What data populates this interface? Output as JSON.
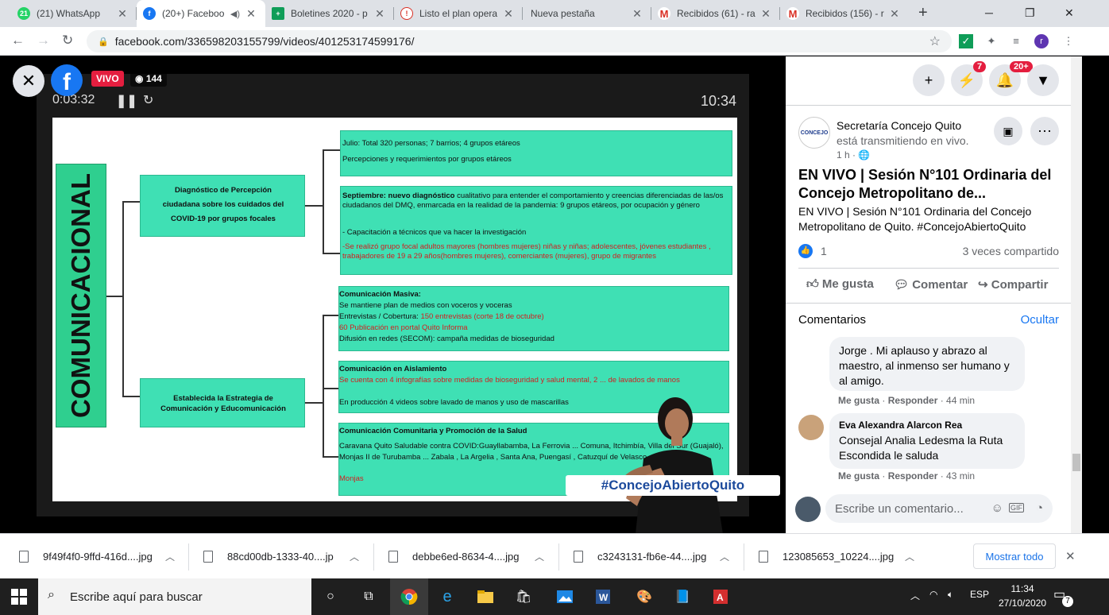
{
  "browser": {
    "tabs": [
      {
        "title": "(21) WhatsApp",
        "badge": "21"
      },
      {
        "title": "(20+) Faceboo"
      },
      {
        "title": "Boletines 2020 - p"
      },
      {
        "title": "Listo el plan opera"
      },
      {
        "title": "Nueva pestaña"
      },
      {
        "title": "Recibidos (61) - ra"
      },
      {
        "title": "Recibidos (156) - r"
      }
    ],
    "url": "facebook.com/336598203155799/videos/401253174599176/",
    "profile_initial": "r"
  },
  "video": {
    "live_label": "VIVO",
    "viewers": "144",
    "elapsed": "0:03:32",
    "clock": "10:34",
    "hashtag": "#ConcejoAbiertoQuito"
  },
  "slide": {
    "vertical_label": "COMUNICACIONAL",
    "box1_title": "Diagnóstico de Percepción ciudadana sobre los cuidados del COVID-19 por grupos focales",
    "box2_title": "Establecida la Estrategia de Comunicación y Educomunicación",
    "r1_line1": "Julio: Total 320 personas; 7 barrios; 4 grupos etáreos",
    "r1_line2": "Percepciones y requerimientos por grupos etáreos",
    "r2_bold": "Septiembre: nuevo diagnóstico",
    "r2_text": "cualitativo para entender el comportamiento y creencias diferenciadas de las/os ciudadanos del DMQ, enmarcada en la realidad de la pandemia: 9 grupos etáreos, por ocupación y género",
    "r2_line2": "- Capacitación a técnicos que va hacer la investigación",
    "r2_red": "-Se realizó grupo focal adultos mayores (hombres mujeres) niñas y niñas; adolescentes, jóvenes estudiantes , trabajadores de 19 a 29 años(hombres mujeres), comerciantes (mujeres), grupo de migrantes",
    "r3_title": "Comunicación Masiva:",
    "r3_l1": "Se mantiene plan de medios con voceros y voceras",
    "r3_l2a": "Entrevistas / Cobertura:",
    "r3_l2b": "150 entrevistas (corte 18 de octubre)",
    "r3_l3": "60 Publicación en portal Quito Informa",
    "r3_l4": "Difusión en redes (SECOM): campaña medidas de bioseguridad",
    "r4_title": "Comunicación en Aislamiento",
    "r4_red": "Se cuenta con 4 infografías sobre medidas de bioseguridad y salud mental, 2 ... de lavados de manos",
    "r4_l2": "En producción 4 videos sobre lavado de manos y uso de mascarillas",
    "r5_title": "Comunicación Comunitaria y Promoción de la Salud",
    "r5_text": "Caravana Quito Saludable contra COVID:Guayllabamba, La Ferrovia ... Comuna, Itchimbía, Villa del Sur (Guajaló), Monjas II de Turubamba ... Zabala , La Argelia , Santa Ana, Puengasí , Catuzquí de Velasco,",
    "r5_red": "Monjas"
  },
  "header": {
    "messenger_badge": "7",
    "notif_badge": "20+"
  },
  "post": {
    "avatar_text": "CONCEJO",
    "author": "Secretaría Concejo Quito",
    "action": "está transmitiendo en vivo.",
    "time": "1 h ·",
    "title": "EN VIVO | Sesión N°101 Ordinaria del Concejo Metropolitano de...",
    "body": "EN VIVO | Sesión N°101 Ordinaria del Concejo Metropolitano de Quito. #ConcejoAbiertoQuito",
    "likes": "1",
    "shares": "3 veces compartido",
    "like_btn": "Me gusta",
    "comment_btn": "Comentar",
    "share_btn": "Compartir"
  },
  "comments": {
    "header": "Comentarios",
    "hide": "Ocultar",
    "items": [
      {
        "text": "Jorge . Mi aplauso y abrazo al maestro, al inmenso ser humano y al amigo.",
        "like": "Me gusta",
        "reply": "Responder",
        "time": "44 min"
      },
      {
        "author": "Eva Alexandra Alarcon Rea",
        "text": "Consejal Analia Ledesma la Ruta Escondida le saluda",
        "like": "Me gusta",
        "reply": "Responder",
        "time": "43 min"
      }
    ],
    "placeholder": "Escribe un comentario..."
  },
  "downloads": {
    "items": [
      "9f49f4f0-9ffd-416d....jpg",
      "88cd00db-1333-40....jp",
      "debbe6ed-8634-4....jpg",
      "c3243131-fb6e-44....jpg",
      "123085653_10224....jpg"
    ],
    "show_all": "Mostrar todo"
  },
  "taskbar": {
    "search": "Escribe aquí para buscar",
    "lang": "ESP",
    "time": "11:34",
    "date": "27/10/2020",
    "notif_count": "7"
  }
}
